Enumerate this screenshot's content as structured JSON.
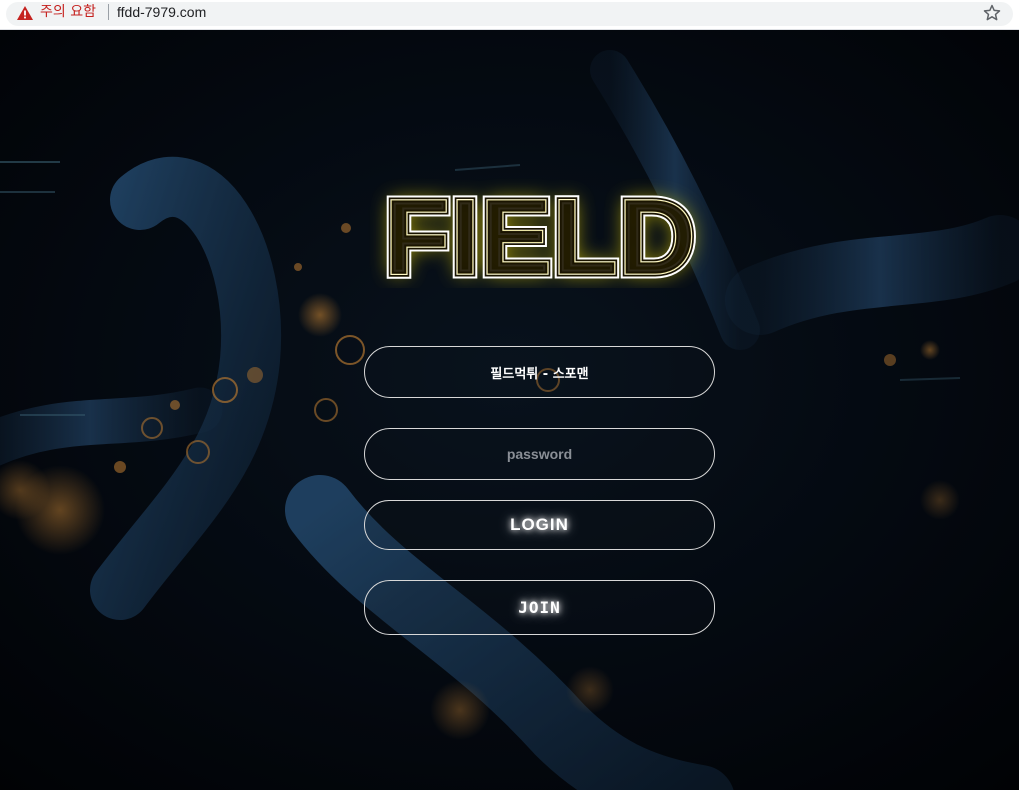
{
  "browser": {
    "warning_icon": "warning-triangle-icon",
    "security_label": "주의 요함",
    "url": "ffdd-7979.com",
    "bookmark_icon": "star-outline-icon"
  },
  "logo": {
    "text": "FIELD",
    "glow_color": "#e8d400"
  },
  "form": {
    "id_value": "필드먹튀 - 스포맨",
    "password_placeholder": "password",
    "login_label": "LOGIN",
    "join_label": "JOIN"
  },
  "colors": {
    "background": "#03070d",
    "border": "#d8d8d8",
    "warning": "#c5221f"
  }
}
